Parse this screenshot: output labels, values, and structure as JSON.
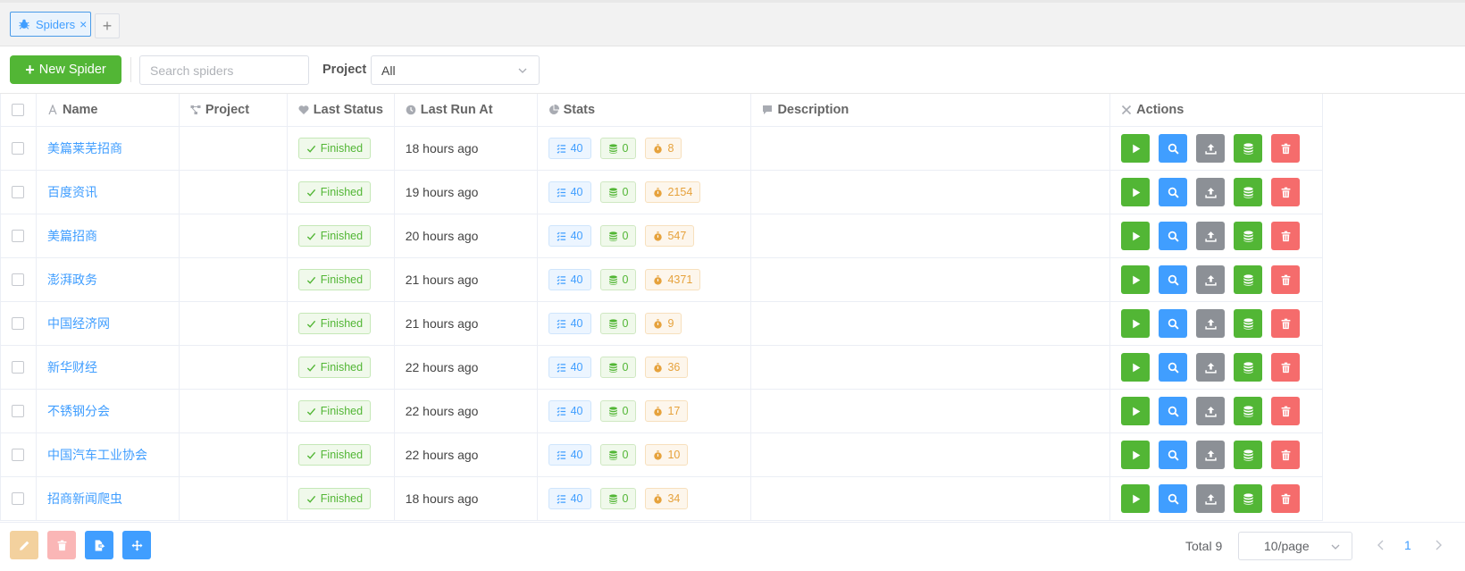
{
  "tabs": [
    {
      "label": "Spiders",
      "close": "×"
    }
  ],
  "tab_add": "+",
  "toolbar": {
    "new_button": "New Spider",
    "search_placeholder": "Search spiders",
    "project_label": "Project",
    "project_value": "All"
  },
  "table": {
    "columns": [
      "Name",
      "Project",
      "Last Status",
      "Last Run At",
      "Stats",
      "Description",
      "Actions"
    ],
    "rows": [
      {
        "name": "美篇莱芜招商",
        "project": "",
        "status": "Finished",
        "last_run": "18 hours ago",
        "tasks": "40",
        "results": "0",
        "duration": "8",
        "description": ""
      },
      {
        "name": "百度资讯",
        "project": "",
        "status": "Finished",
        "last_run": "19 hours ago",
        "tasks": "40",
        "results": "0",
        "duration": "2154",
        "description": ""
      },
      {
        "name": "美篇招商",
        "project": "",
        "status": "Finished",
        "last_run": "20 hours ago",
        "tasks": "40",
        "results": "0",
        "duration": "547",
        "description": ""
      },
      {
        "name": "澎湃政务",
        "project": "",
        "status": "Finished",
        "last_run": "21 hours ago",
        "tasks": "40",
        "results": "0",
        "duration": "4371",
        "description": ""
      },
      {
        "name": "中国经济网",
        "project": "",
        "status": "Finished",
        "last_run": "21 hours ago",
        "tasks": "40",
        "results": "0",
        "duration": "9",
        "description": ""
      },
      {
        "name": "新华财经",
        "project": "",
        "status": "Finished",
        "last_run": "22 hours ago",
        "tasks": "40",
        "results": "0",
        "duration": "36",
        "description": ""
      },
      {
        "name": "不锈钢分会",
        "project": "",
        "status": "Finished",
        "last_run": "22 hours ago",
        "tasks": "40",
        "results": "0",
        "duration": "17",
        "description": ""
      },
      {
        "name": "中国汽车工业协会",
        "project": "",
        "status": "Finished",
        "last_run": "22 hours ago",
        "tasks": "40",
        "results": "0",
        "duration": "10",
        "description": ""
      },
      {
        "name": "招商新闻爬虫",
        "project": "",
        "status": "Finished",
        "last_run": "18 hours ago",
        "tasks": "40",
        "results": "0",
        "duration": "34",
        "description": ""
      }
    ]
  },
  "footer": {
    "total": "Total 9",
    "page_size": "10/page",
    "current_page": "1"
  },
  "colors": {
    "primary": "#409eff",
    "success": "#52b635",
    "warning": "#e6a23c",
    "danger": "#f56c6c",
    "info": "#8c9096"
  },
  "icons": [
    "bug-icon",
    "close-icon",
    "plus-icon",
    "chevron-down-icon",
    "checkbox-icon",
    "play-icon",
    "search-icon",
    "upload-icon",
    "database-icon",
    "trash-icon",
    "edit-icon",
    "export-icon",
    "move-icon",
    "tasks-icon",
    "timer-icon",
    "check-icon"
  ]
}
